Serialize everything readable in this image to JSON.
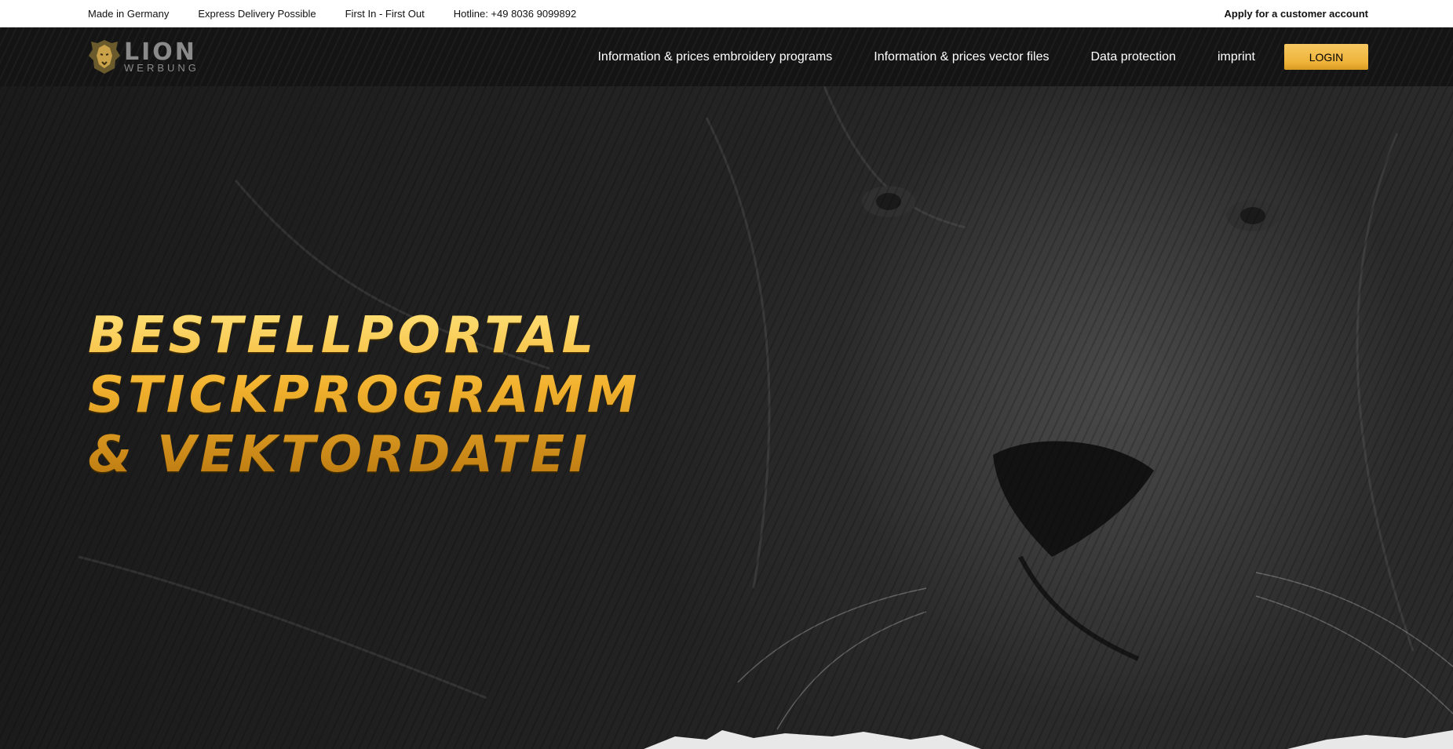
{
  "topbar": {
    "items": [
      "Made in Germany",
      "Express Delivery Possible",
      "First In - First Out",
      "Hotline: +49 8036 9099892"
    ],
    "apply_link": "Apply for a customer account"
  },
  "logo": {
    "name": "LION",
    "sub": "WERBUNG"
  },
  "nav": {
    "links": [
      "Information & prices embroidery programs",
      "Information & prices vector files",
      "Data protection",
      "imprint"
    ],
    "login_label": "LOGIN"
  },
  "hero": {
    "title_lines": [
      "BESTELLPORTAL",
      "STICKPROGRAMM",
      "& VEKTORDATEI"
    ]
  },
  "colors": {
    "accent": "#efb43a",
    "nav_bg": "#141414",
    "topbar_bg": "#ffffff"
  },
  "icons": [
    "lion-head-icon"
  ]
}
